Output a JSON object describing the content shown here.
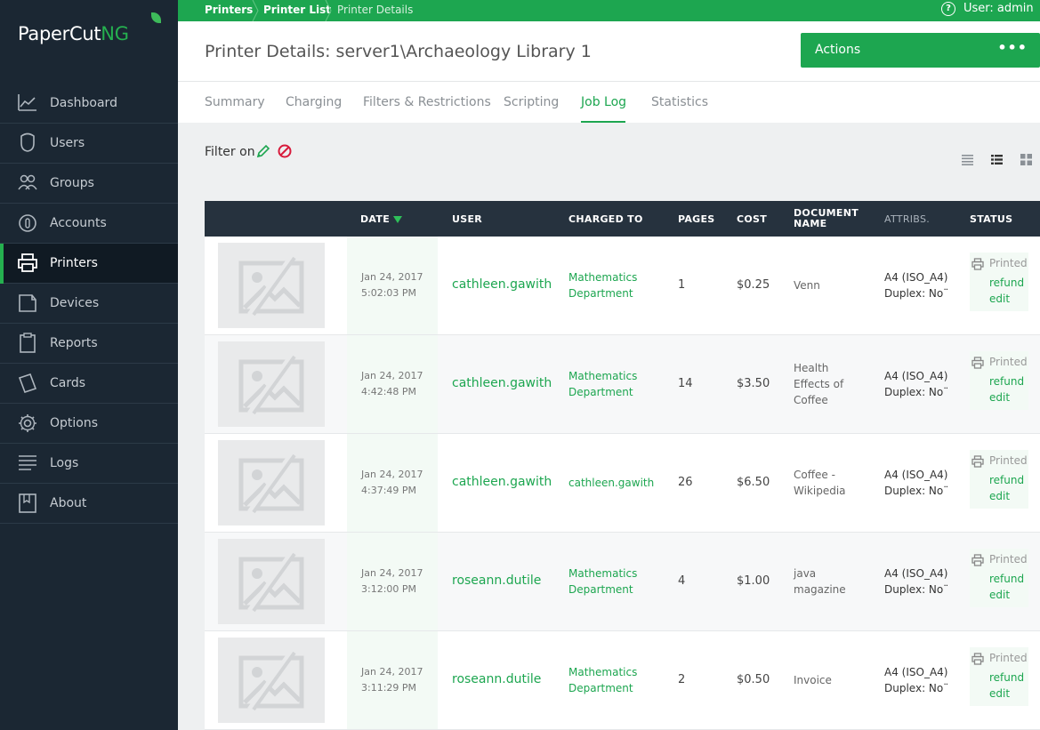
{
  "app": {
    "logo_main": "PaperCut",
    "logo_suffix": "NG"
  },
  "colors": {
    "brand_green": "#1da650",
    "sidebar_bg": "#1b2733",
    "table_header_bg": "#26323e"
  },
  "sidebar": {
    "items": [
      {
        "label": "Dashboard",
        "icon": "dashboard-icon"
      },
      {
        "label": "Users",
        "icon": "users-icon"
      },
      {
        "label": "Groups",
        "icon": "groups-icon"
      },
      {
        "label": "Accounts",
        "icon": "accounts-icon"
      },
      {
        "label": "Printers",
        "icon": "printer-icon",
        "active": true
      },
      {
        "label": "Devices",
        "icon": "devices-icon"
      },
      {
        "label": "Reports",
        "icon": "reports-icon"
      },
      {
        "label": "Cards",
        "icon": "cards-icon"
      },
      {
        "label": "Options",
        "icon": "gear-icon"
      },
      {
        "label": "Logs",
        "icon": "logs-icon"
      },
      {
        "label": "About",
        "icon": "about-icon"
      }
    ]
  },
  "breadcrumb": [
    "Printers",
    "Printer List",
    "Printer Details"
  ],
  "topbar": {
    "user_label": "User: admin"
  },
  "header": {
    "title": "Printer Details: server1\\Archaeology Library 1",
    "actions_label": "Actions",
    "actions_more": "•••"
  },
  "tabs": [
    "Summary",
    "Charging",
    "Filters & Restrictions",
    "Scripting",
    "Job Log",
    "Statistics"
  ],
  "active_tab": "Job Log",
  "filter": {
    "label": "Filter on"
  },
  "table": {
    "headers": {
      "date": "DATE",
      "user": "USER",
      "charged_to": "CHARGED TO",
      "pages": "PAGES",
      "cost": "COST",
      "document_name_1": "DOCUMENT",
      "document_name_2": "NAME",
      "attribs": "ATTRIBS.",
      "status": "STATUS"
    },
    "rows": [
      {
        "date": "Jan 24, 2017",
        "time": "5:02:03 PM",
        "user": "cathleen.gawith",
        "charged_lines": [
          "Mathematics",
          "Department"
        ],
        "pages": "1",
        "cost": "$0.25",
        "doc_lines": [
          "Venn"
        ],
        "attr1": "A4 (ISO_A4)",
        "attr2": "Duplex: No¨",
        "status": "Printed",
        "refund": "refund",
        "edit": "edit"
      },
      {
        "date": "Jan 24, 2017",
        "time": "4:42:48 PM",
        "user": "cathleen.gawith",
        "charged_lines": [
          "Mathematics",
          "Department"
        ],
        "pages": "14",
        "cost": "$3.50",
        "doc_lines": [
          "Health",
          "Effects of",
          "Coffee"
        ],
        "attr1": "A4 (ISO_A4)",
        "attr2": "Duplex: No¨",
        "status": "Printed",
        "refund": "refund",
        "edit": "edit"
      },
      {
        "date": "Jan 24, 2017",
        "time": "4:37:49 PM",
        "user": "cathleen.gawith",
        "charged_lines": [
          "cathleen.gawith"
        ],
        "pages": "26",
        "cost": "$6.50",
        "doc_lines": [
          "Coffee -",
          "Wikipedia"
        ],
        "attr1": "A4 (ISO_A4)",
        "attr2": "Duplex: No¨",
        "status": "Printed",
        "refund": "refund",
        "edit": "edit"
      },
      {
        "date": "Jan 24, 2017",
        "time": "3:12:00 PM",
        "user": "roseann.dutile",
        "charged_lines": [
          "Mathematics",
          "Department"
        ],
        "pages": "4",
        "cost": "$1.00",
        "doc_lines": [
          "java",
          "magazine"
        ],
        "attr1": "A4 (ISO_A4)",
        "attr2": "Duplex: No¨",
        "status": "Printed",
        "refund": "refund",
        "edit": "edit"
      },
      {
        "date": "Jan 24, 2017",
        "time": "3:11:29 PM",
        "user": "roseann.dutile",
        "charged_lines": [
          "Mathematics",
          "Department"
        ],
        "pages": "2",
        "cost": "$0.50",
        "doc_lines": [
          "Invoice"
        ],
        "attr1": "A4 (ISO_A4)",
        "attr2": "Duplex: No¨",
        "status": "Printed",
        "refund": "refund",
        "edit": "edit"
      }
    ]
  }
}
